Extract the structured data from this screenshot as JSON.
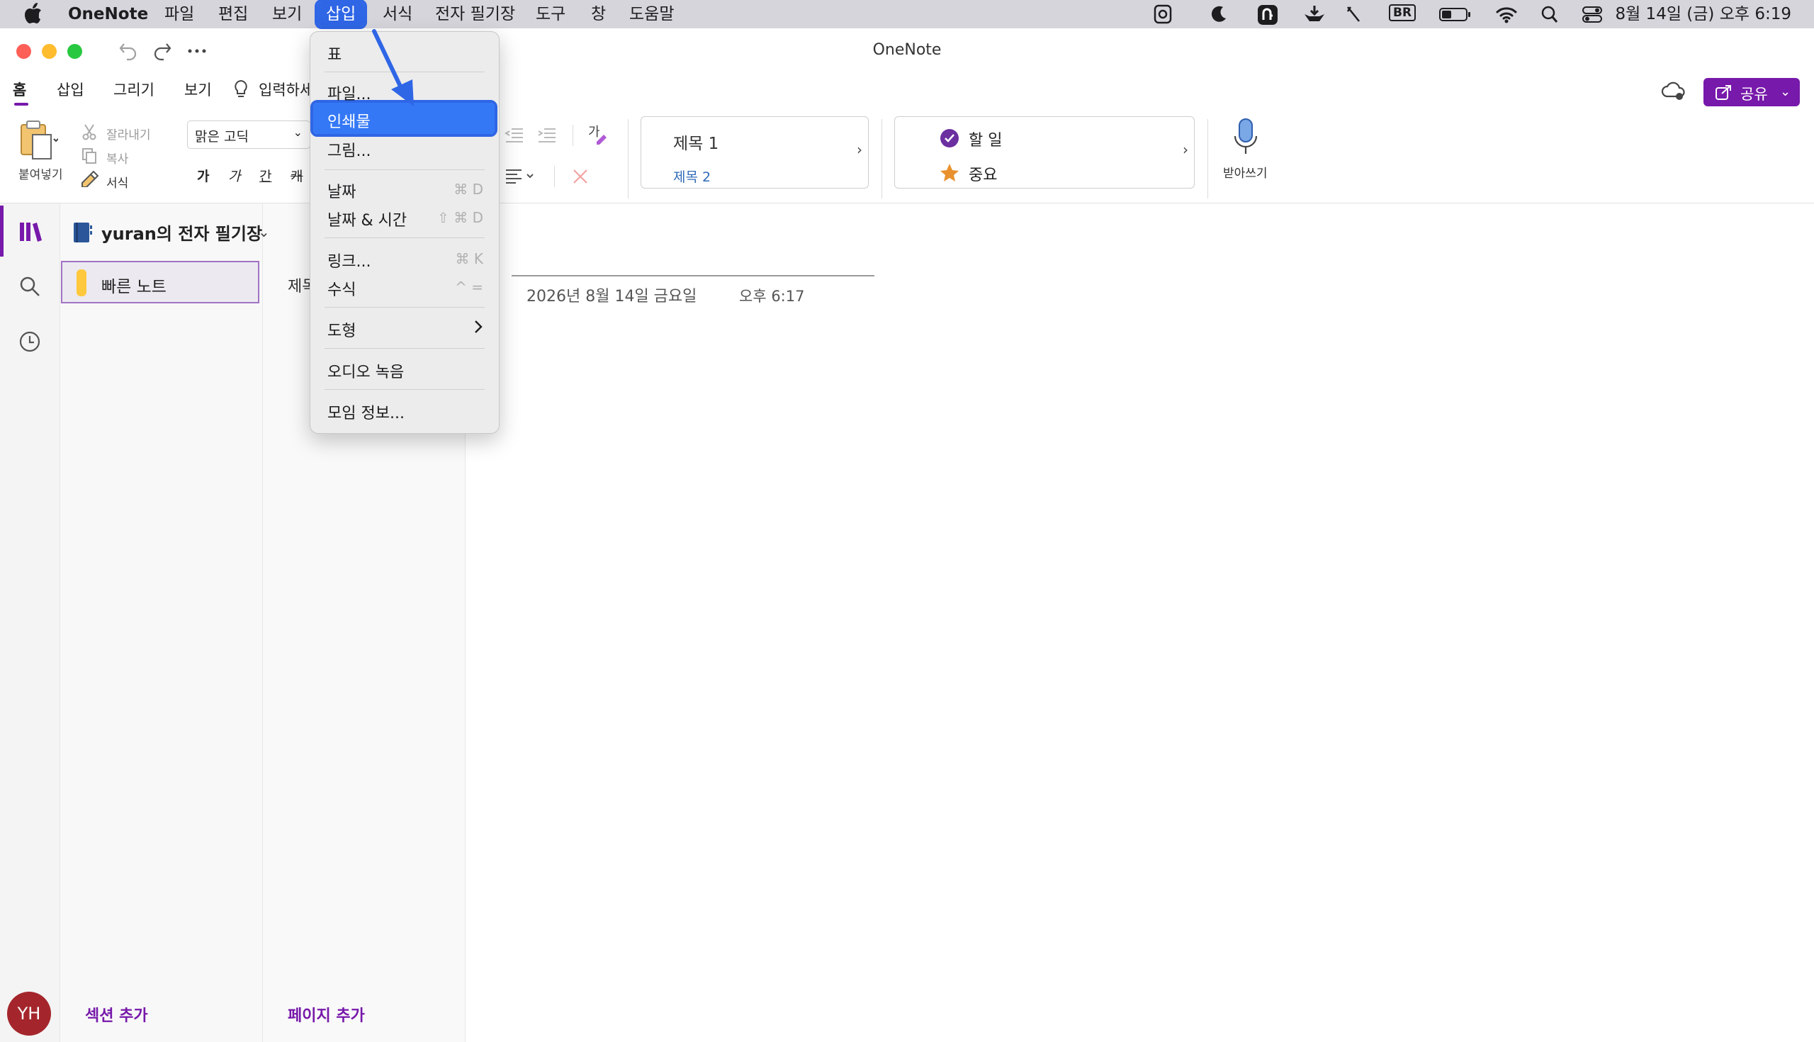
{
  "menubar": {
    "app_name": "OneNote",
    "items": [
      "파일",
      "편집",
      "보기",
      "삽입",
      "서식",
      "전자 필기장",
      "도구",
      "창",
      "도움말"
    ],
    "active_item": "삽입",
    "status_icons": [
      "onenote-status-icon",
      "moon-icon",
      "text-tool-icon",
      "download-tray-icon",
      "pen-icon",
      "input-source-icon",
      "battery-icon",
      "wifi-icon",
      "spotlight-icon",
      "control-center-icon"
    ],
    "input_source": "BR",
    "clock": "8월 14일 (금) 오후 6:19"
  },
  "window": {
    "title": "OneNote"
  },
  "ribbon": {
    "tabs": [
      "홈",
      "삽입",
      "그리기",
      "보기"
    ],
    "selected_tab": "홈",
    "tell_me": "입력하세",
    "paste_label": "붙여넣기",
    "cut_label": "잘라내기",
    "copy_label": "복사",
    "format_label": "서식",
    "font_name": "맑은 고딕",
    "bold_glyph": "가",
    "italic_glyph": "가",
    "underline_glyph": "간",
    "strike_glyph": "캐",
    "styles": {
      "heading1": "제목 1",
      "heading2": "제목 2"
    },
    "tags": {
      "todo": "할 일",
      "important": "중요"
    },
    "dictate_label": "받아쓰기",
    "share_label": "공유"
  },
  "insert_menu": {
    "items": [
      {
        "label": "표",
        "shortcut": ""
      },
      {
        "label": "파일...",
        "shortcut": ""
      },
      {
        "label": "인쇄물",
        "shortcut": "",
        "highlighted": true
      },
      {
        "label": "그림...",
        "shortcut": ""
      },
      {
        "label": "날짜",
        "shortcut": "⌘ D"
      },
      {
        "label": "날짜 & 시간",
        "shortcut": "⇧ ⌘ D"
      },
      {
        "label": "링크...",
        "shortcut": "⌘ K"
      },
      {
        "label": "수식",
        "shortcut": "^ ="
      },
      {
        "label": "도형",
        "shortcut": "",
        "submenu": true
      },
      {
        "label": "오디오 녹음",
        "shortcut": ""
      },
      {
        "label": "모임 정보...",
        "shortcut": ""
      }
    ]
  },
  "sidebar": {
    "notebook_name": "yuran의 전자 필기장",
    "section": "빠른 노트",
    "page": "제목",
    "add_section": "섹션 추가",
    "add_page": "페이지 추가",
    "avatar_initials": "YH"
  },
  "page": {
    "date": "2026년 8월 14일 금요일",
    "time": "오후 6:17"
  },
  "colors": {
    "accent": "#7719aa",
    "highlight": "#3478f6",
    "section_tab": "#ffc83d",
    "avatar": "#a4262c"
  }
}
